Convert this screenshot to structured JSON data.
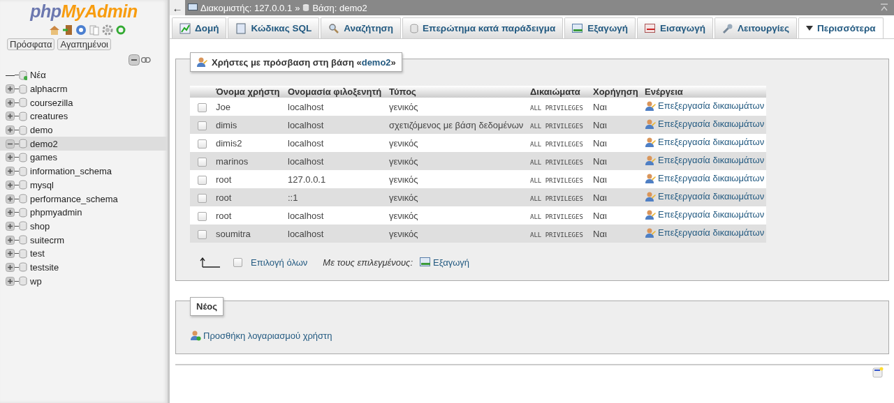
{
  "sidebar": {
    "logo_prefix": "php",
    "logo_main": "MyAdmin",
    "quick_tabs": [
      "Πρόσφατα",
      "Αγαπημένοι"
    ],
    "tree": [
      {
        "label": "Νέα",
        "kind": "new",
        "selected": false
      },
      {
        "label": "alphacrm",
        "kind": "db",
        "expanded": false,
        "selected": false
      },
      {
        "label": "coursezilla",
        "kind": "db",
        "expanded": false,
        "selected": false
      },
      {
        "label": "creatures",
        "kind": "db",
        "expanded": false,
        "selected": false
      },
      {
        "label": "demo",
        "kind": "db",
        "expanded": false,
        "selected": false
      },
      {
        "label": "demo2",
        "kind": "db",
        "expanded": true,
        "selected": true
      },
      {
        "label": "games",
        "kind": "db",
        "expanded": false,
        "selected": false
      },
      {
        "label": "information_schema",
        "kind": "db",
        "expanded": false,
        "selected": false
      },
      {
        "label": "mysql",
        "kind": "db",
        "expanded": false,
        "selected": false
      },
      {
        "label": "performance_schema",
        "kind": "db",
        "expanded": false,
        "selected": false
      },
      {
        "label": "phpmyadmin",
        "kind": "db",
        "expanded": false,
        "selected": false
      },
      {
        "label": "shop",
        "kind": "db",
        "expanded": false,
        "selected": false
      },
      {
        "label": "suitecrm",
        "kind": "db",
        "expanded": false,
        "selected": false
      },
      {
        "label": "test",
        "kind": "db",
        "expanded": false,
        "selected": false
      },
      {
        "label": "testsite",
        "kind": "db",
        "expanded": false,
        "selected": false
      },
      {
        "label": "wp",
        "kind": "db",
        "expanded": false,
        "selected": false
      }
    ]
  },
  "breadcrumb": {
    "back": "←",
    "server": "Διακομιστής: 127.0.0.1",
    "separator": "»",
    "database": "Βάση: demo2"
  },
  "tabs": [
    {
      "label": "Δομή",
      "selected": false
    },
    {
      "label": "Κώδικας SQL",
      "selected": false
    },
    {
      "label": "Αναζήτηση",
      "selected": false
    },
    {
      "label": "Επερώτημα κατά παράδειγμα",
      "selected": false
    },
    {
      "label": "Εξαγωγή",
      "selected": false
    },
    {
      "label": "Εισαγωγή",
      "selected": false
    },
    {
      "label": "Λειτουργίες",
      "selected": false
    },
    {
      "label": "Περισσότερα",
      "selected": true
    }
  ],
  "users_panel": {
    "legend_prefix": "Χρήστες με πρόσβαση στη βάση «",
    "legend_db": "demo2",
    "legend_suffix": "»",
    "columns": [
      "Όνομα χρήστη",
      "Ονομασία φιλοξενητή",
      "Τύπος",
      "Δικαιώματα",
      "Χορήγηση",
      "Ενέργεια"
    ],
    "rows": [
      {
        "user": "Joe",
        "host": "localhost",
        "type": "γενικός",
        "privileges": "ALL PRIVILEGES",
        "grant": "Ναι",
        "action": "Επεξεργασία δικαιωμάτων",
        "checked": false
      },
      {
        "user": "dimis",
        "host": "localhost",
        "type": "σχετιζόμενος με βάση δεδομένων",
        "privileges": "ALL PRIVILEGES",
        "grant": "Ναι",
        "action": "Επεξεργασία δικαιωμάτων",
        "checked": false
      },
      {
        "user": "dimis2",
        "host": "localhost",
        "type": "γενικός",
        "privileges": "ALL PRIVILEGES",
        "grant": "Ναι",
        "action": "Επεξεργασία δικαιωμάτων",
        "checked": false
      },
      {
        "user": "marinos",
        "host": "localhost",
        "type": "γενικός",
        "privileges": "ALL PRIVILEGES",
        "grant": "Ναι",
        "action": "Επεξεργασία δικαιωμάτων",
        "checked": false
      },
      {
        "user": "root",
        "host": "127.0.0.1",
        "type": "γενικός",
        "privileges": "ALL PRIVILEGES",
        "grant": "Ναι",
        "action": "Επεξεργασία δικαιωμάτων",
        "checked": false
      },
      {
        "user": "root",
        "host": "::1",
        "type": "γενικός",
        "privileges": "ALL PRIVILEGES",
        "grant": "Ναι",
        "action": "Επεξεργασία δικαιωμάτων",
        "checked": false
      },
      {
        "user": "root",
        "host": "localhost",
        "type": "γενικός",
        "privileges": "ALL PRIVILEGES",
        "grant": "Ναι",
        "action": "Επεξεργασία δικαιωμάτων",
        "checked": false
      },
      {
        "user": "soumitra",
        "host": "localhost",
        "type": "γενικός",
        "privileges": "ALL PRIVILEGES",
        "grant": "Ναι",
        "action": "Επεξεργασία δικαιωμάτων",
        "checked": false
      }
    ],
    "select_all": {
      "label": "Επιλογή όλων",
      "checked": false
    },
    "with_selected": "Με τους επιλεγμένους:",
    "bulk_action": "Εξαγωγή"
  },
  "new_panel": {
    "legend": "Νέος",
    "link": "Προσθήκη λογαριασμού χρήστη"
  }
}
